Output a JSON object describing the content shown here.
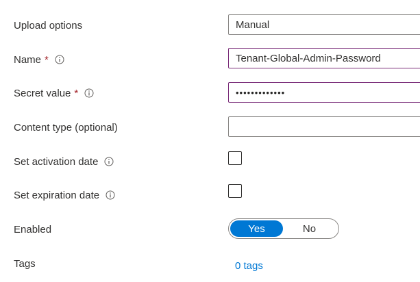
{
  "form": {
    "upload_options": {
      "label": "Upload options",
      "value": "Manual"
    },
    "name": {
      "label": "Name",
      "required_marker": "*",
      "value": "Tenant-Global-Admin-Password"
    },
    "secret_value": {
      "label": "Secret value",
      "required_marker": "*",
      "masked_value": "•••••••••••••"
    },
    "content_type": {
      "label": "Content type (optional)",
      "value": ""
    },
    "activation_date": {
      "label": "Set activation date",
      "checked": false
    },
    "expiration_date": {
      "label": "Set expiration date",
      "checked": false
    },
    "enabled": {
      "label": "Enabled",
      "options": [
        "Yes",
        "No"
      ],
      "selected": "Yes"
    },
    "tags": {
      "label": "Tags",
      "link_text": "0 tags"
    }
  },
  "colors": {
    "required": "#a4262c",
    "accent": "#0078d4",
    "focus_border": "#7a2d79"
  },
  "icons": {
    "info": "info-icon"
  }
}
